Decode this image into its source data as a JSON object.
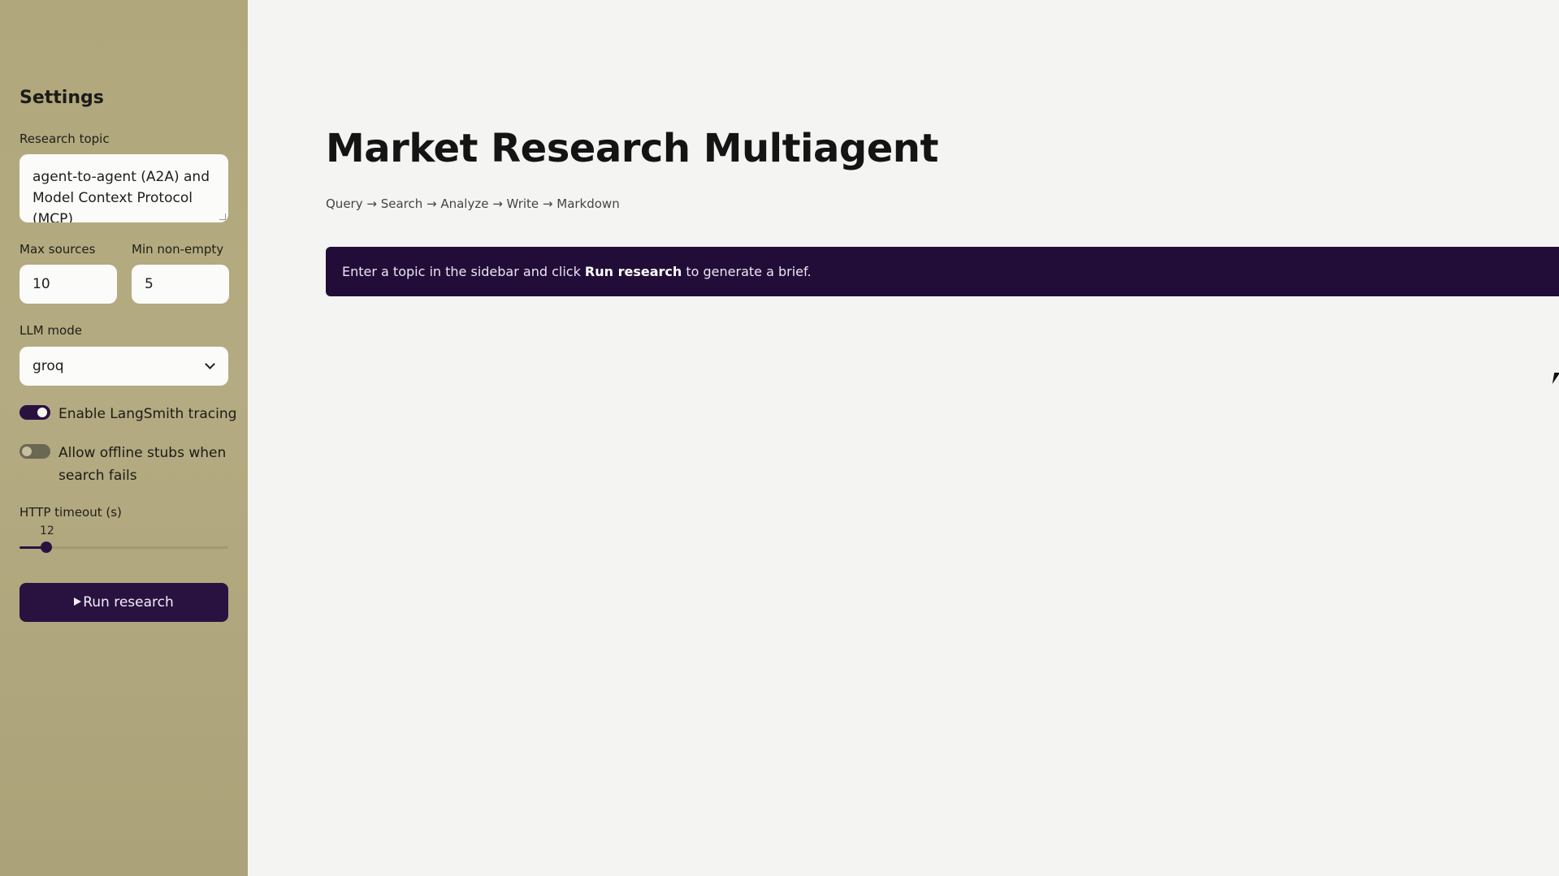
{
  "sidebar": {
    "title": "Settings",
    "research_topic": {
      "label": "Research topic",
      "value": "agent-to-agent (A2A) and Model Context Protocol (MCP)"
    },
    "max_sources": {
      "label": "Max sources",
      "value": "10"
    },
    "min_non_empty": {
      "label": "Min non-empty",
      "value": "5"
    },
    "llm_mode": {
      "label": "LLM mode",
      "value": "groq"
    },
    "toggles": [
      {
        "label": "Enable LangSmith tracing",
        "on": true
      },
      {
        "label": "Allow offline stubs when search fails",
        "on": false
      }
    ],
    "http_timeout": {
      "label": "HTTP timeout (s)",
      "value": "12",
      "fraction": 0.13
    },
    "run_button": {
      "label": "Run research",
      "icon": "play-icon"
    }
  },
  "main": {
    "title": "Market Research Multiagent",
    "pipeline": "Query → Search → Analyze → Write → Markdown",
    "banner": {
      "prefix": "Enter a topic in the sidebar and click ",
      "bold": "Run research",
      "suffix": " to generate a brief."
    }
  },
  "colors": {
    "sidebar_bg": "#b3aa80",
    "accent": "#2a1240",
    "banner_bg": "#220d38",
    "main_bg": "#f4f4f2"
  }
}
